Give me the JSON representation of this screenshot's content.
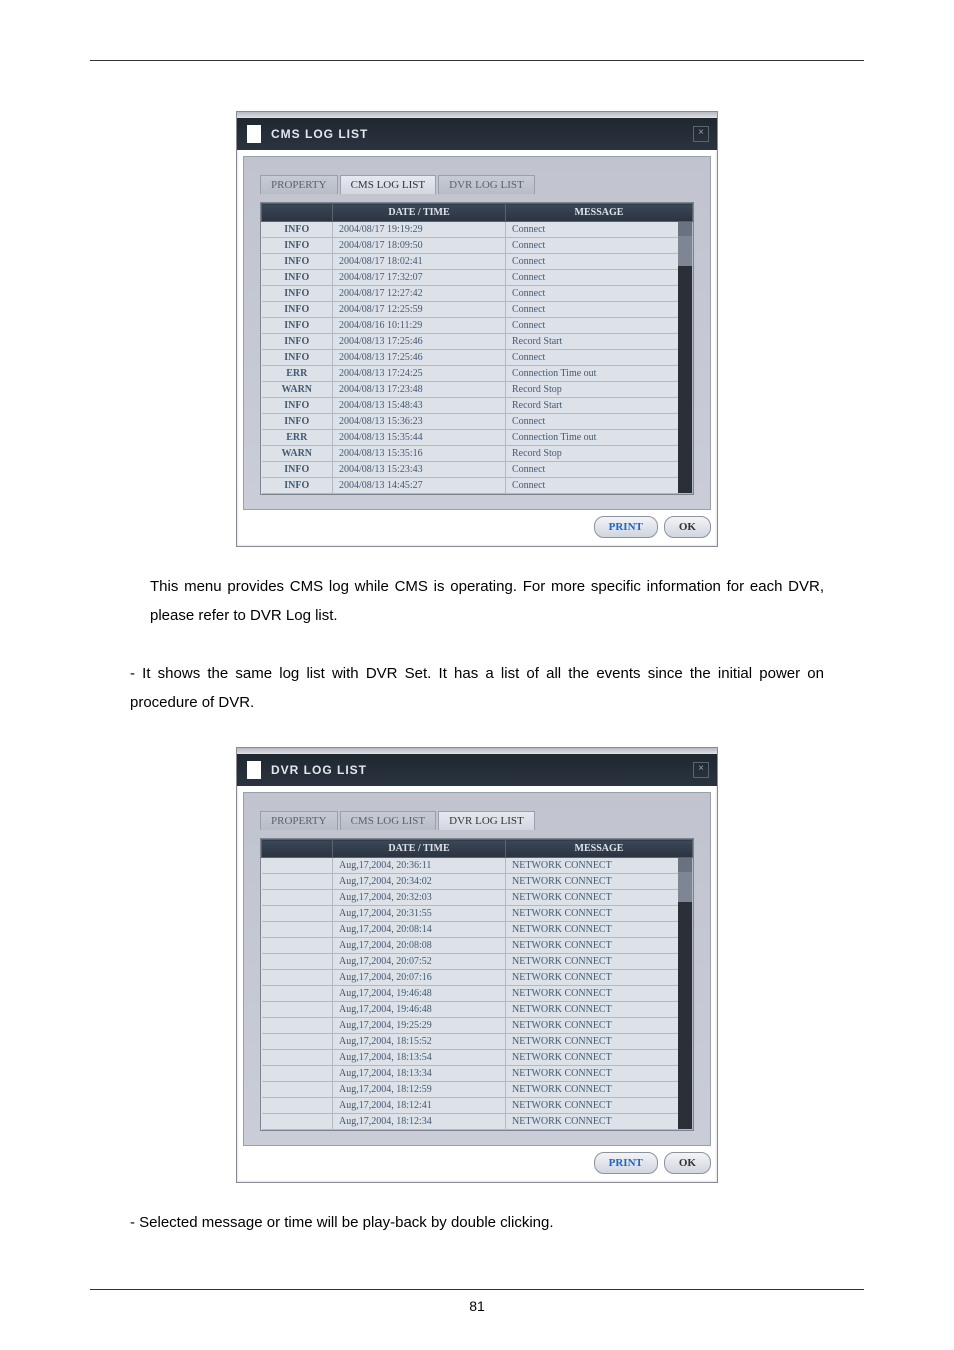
{
  "page_number": "81",
  "dialog1": {
    "title": "CMS LOG LIST",
    "close": "×",
    "tabs": {
      "property": "PROPERTY",
      "cms": "CMS LOG LIST",
      "dvr": "DVR LOG LIST"
    },
    "headers": {
      "level": "",
      "date": "DATE / TIME",
      "msg": "MESSAGE"
    },
    "rows": [
      {
        "lvl": "INFO",
        "dt": "2004/08/17 19:19:29",
        "msg": "Connect"
      },
      {
        "lvl": "INFO",
        "dt": "2004/08/17 18:09:50",
        "msg": "Connect"
      },
      {
        "lvl": "INFO",
        "dt": "2004/08/17 18:02:41",
        "msg": "Connect"
      },
      {
        "lvl": "INFO",
        "dt": "2004/08/17 17:32:07",
        "msg": "Connect"
      },
      {
        "lvl": "INFO",
        "dt": "2004/08/17 12:27:42",
        "msg": "Connect"
      },
      {
        "lvl": "INFO",
        "dt": "2004/08/17 12:25:59",
        "msg": "Connect"
      },
      {
        "lvl": "INFO",
        "dt": "2004/08/16 10:11:29",
        "msg": "Connect"
      },
      {
        "lvl": "INFO",
        "dt": "2004/08/13 17:25:46",
        "msg": "Record Start"
      },
      {
        "lvl": "INFO",
        "dt": "2004/08/13 17:25:46",
        "msg": "Connect"
      },
      {
        "lvl": "ERR",
        "dt": "2004/08/13 17:24:25",
        "msg": "Connection Time out"
      },
      {
        "lvl": "WARN",
        "dt": "2004/08/13 17:23:48",
        "msg": "Record Stop"
      },
      {
        "lvl": "INFO",
        "dt": "2004/08/13 15:48:43",
        "msg": "Record Start"
      },
      {
        "lvl": "INFO",
        "dt": "2004/08/13 15:36:23",
        "msg": "Connect"
      },
      {
        "lvl": "ERR",
        "dt": "2004/08/13 15:35:44",
        "msg": "Connection Time out"
      },
      {
        "lvl": "WARN",
        "dt": "2004/08/13 15:35:16",
        "msg": "Record Stop"
      },
      {
        "lvl": "INFO",
        "dt": "2004/08/13 15:23:43",
        "msg": "Connect"
      },
      {
        "lvl": "INFO",
        "dt": "2004/08/13 14:45:27",
        "msg": "Connect"
      }
    ],
    "print": "PRINT",
    "ok": "OK"
  },
  "para1": "This menu provides CMS log while CMS is operating. For more specific information for each DVR, please refer to DVR Log list.",
  "para2": "- It shows the same log list with DVR Set. It has a list of all the events since the initial power on procedure of DVR.",
  "dialog2": {
    "title": "DVR LOG LIST",
    "close": "×",
    "tabs": {
      "property": "PROPERTY",
      "cms": "CMS LOG LIST",
      "dvr": "DVR LOG LIST"
    },
    "headers": {
      "level": "",
      "date": "DATE / TIME",
      "msg": "MESSAGE"
    },
    "rows": [
      {
        "lvl": "",
        "dt": "Aug,17,2004, 20:36:11",
        "msg": "NETWORK CONNECT"
      },
      {
        "lvl": "",
        "dt": "Aug,17,2004, 20:34:02",
        "msg": "NETWORK CONNECT"
      },
      {
        "lvl": "",
        "dt": "Aug,17,2004, 20:32:03",
        "msg": "NETWORK CONNECT"
      },
      {
        "lvl": "",
        "dt": "Aug,17,2004, 20:31:55",
        "msg": "NETWORK CONNECT"
      },
      {
        "lvl": "",
        "dt": "Aug,17,2004, 20:08:14",
        "msg": "NETWORK CONNECT"
      },
      {
        "lvl": "",
        "dt": "Aug,17,2004, 20:08:08",
        "msg": "NETWORK CONNECT"
      },
      {
        "lvl": "",
        "dt": "Aug,17,2004, 20:07:52",
        "msg": "NETWORK CONNECT"
      },
      {
        "lvl": "",
        "dt": "Aug,17,2004, 20:07:16",
        "msg": "NETWORK CONNECT"
      },
      {
        "lvl": "",
        "dt": "Aug,17,2004, 19:46:48",
        "msg": "NETWORK CONNECT"
      },
      {
        "lvl": "",
        "dt": "Aug,17,2004, 19:46:48",
        "msg": "NETWORK CONNECT"
      },
      {
        "lvl": "",
        "dt": "Aug,17,2004, 19:25:29",
        "msg": "NETWORK CONNECT"
      },
      {
        "lvl": "",
        "dt": "Aug,17,2004, 18:15:52",
        "msg": "NETWORK CONNECT"
      },
      {
        "lvl": "",
        "dt": "Aug,17,2004, 18:13:54",
        "msg": "NETWORK CONNECT"
      },
      {
        "lvl": "",
        "dt": "Aug,17,2004, 18:13:34",
        "msg": "NETWORK CONNECT"
      },
      {
        "lvl": "",
        "dt": "Aug,17,2004, 18:12:59",
        "msg": "NETWORK CONNECT"
      },
      {
        "lvl": "",
        "dt": "Aug,17,2004, 18:12:41",
        "msg": "NETWORK CONNECT"
      },
      {
        "lvl": "",
        "dt": "Aug,17,2004, 18:12:34",
        "msg": "NETWORK CONNECT"
      }
    ],
    "print": "PRINT",
    "ok": "OK"
  },
  "para3": "- Selected message or time will be play-back by double clicking."
}
